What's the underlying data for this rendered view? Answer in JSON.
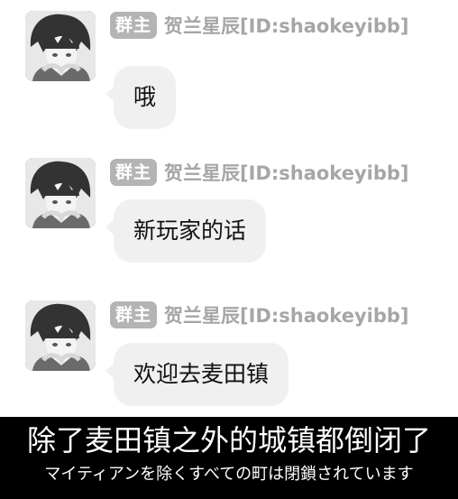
{
  "messages": [
    {
      "badge": "群主",
      "sender": "贺兰星辰[ID:shaokeyibb]",
      "text": "哦"
    },
    {
      "badge": "群主",
      "sender": "贺兰星辰[ID:shaokeyibb]",
      "text": "新玩家的话"
    },
    {
      "badge": "群主",
      "sender": "贺兰星辰[ID:shaokeyibb]",
      "text": "欢迎去麦田镇"
    }
  ],
  "subtitle": {
    "main": "除了麦田镇之外的城镇都倒闭了",
    "japanese": "マイティアンを除くすべての町は閉鎖されています"
  }
}
